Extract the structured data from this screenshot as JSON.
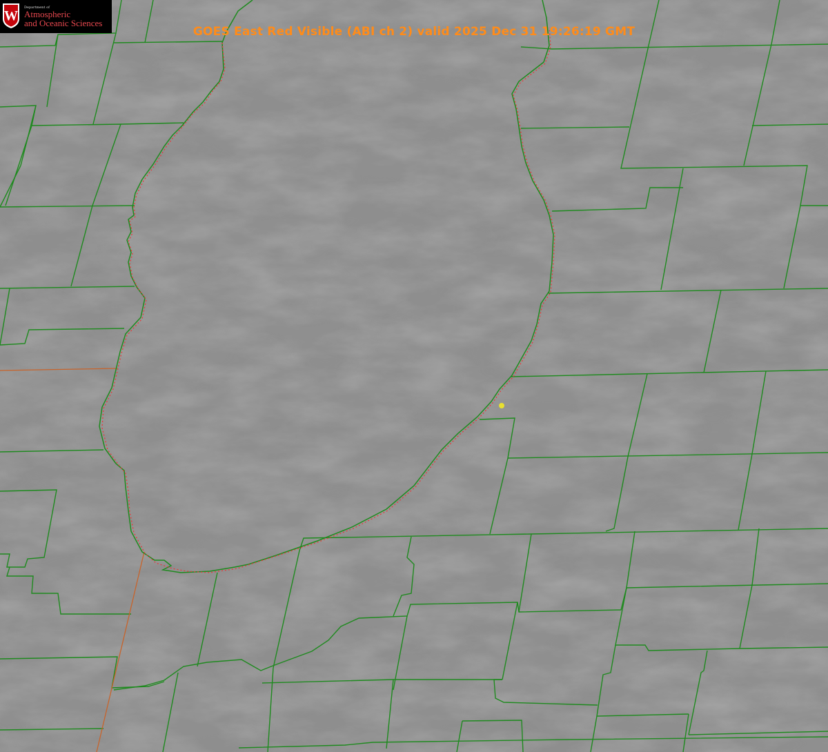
{
  "title": "GOES East Red Visible (ABI ch 2) valid 2025 Dec 31 19:26:19 GMT",
  "logo": {
    "department_line": "Department of",
    "line1": "Atmospheric",
    "line2": "and Oceanic Sciences",
    "crest_letter": "W"
  },
  "colors": {
    "background_gray": "#8a8a8a",
    "county_lines": "#1e8a1e",
    "state_line": "#d9602a",
    "shoreline_dotted": "#e83a3a",
    "marker": "#e8e030",
    "title_text": "#ff8c1a",
    "logo_red": "#c5050c"
  },
  "map": {
    "imagery": "cloudy visible satellite imagery",
    "features": [
      "county-boundaries",
      "state-boundary",
      "lake-michigan-shoreline",
      "location-marker"
    ]
  }
}
